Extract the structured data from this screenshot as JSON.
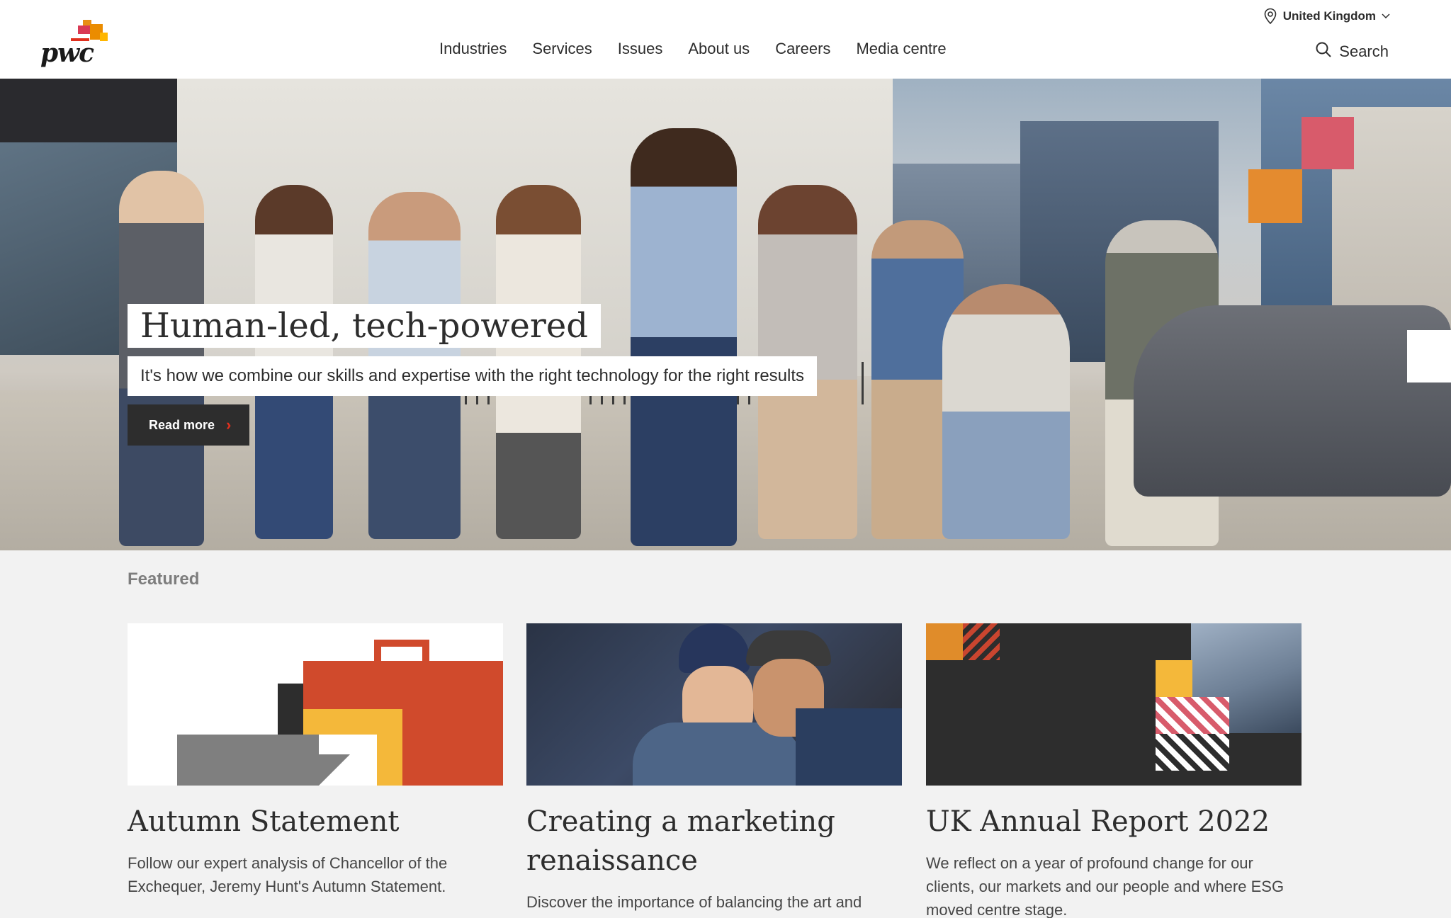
{
  "header": {
    "logo_text": "pwc",
    "region": "United Kingdom",
    "nav": [
      "Industries",
      "Services",
      "Issues",
      "About us",
      "Careers",
      "Media centre"
    ],
    "search_label": "Search"
  },
  "hero": {
    "title": "Human-led, tech-powered",
    "subtitle": "It's how we combine our skills and expertise with the right technology for the right results",
    "cta": "Read more"
  },
  "featured": {
    "label": "Featured",
    "cards": [
      {
        "title": "Autumn Statement",
        "description": "Follow our expert analysis of Chancellor of the Exchequer, Jeremy Hunt's Autumn Statement."
      },
      {
        "title": "Creating a marketing renaissance",
        "description": "Discover the importance of balancing the art and"
      },
      {
        "title": "UK Annual Report 2022",
        "description": "We reflect on a year of profound change for our clients, our markets and our people and where ESG moved centre stage."
      }
    ]
  },
  "colors": {
    "brand_orange": "#e88d14",
    "brand_red": "#e0301e",
    "brand_rose": "#d85b6b",
    "brand_yellow": "#ffb600",
    "dark": "#2d2d2d"
  }
}
